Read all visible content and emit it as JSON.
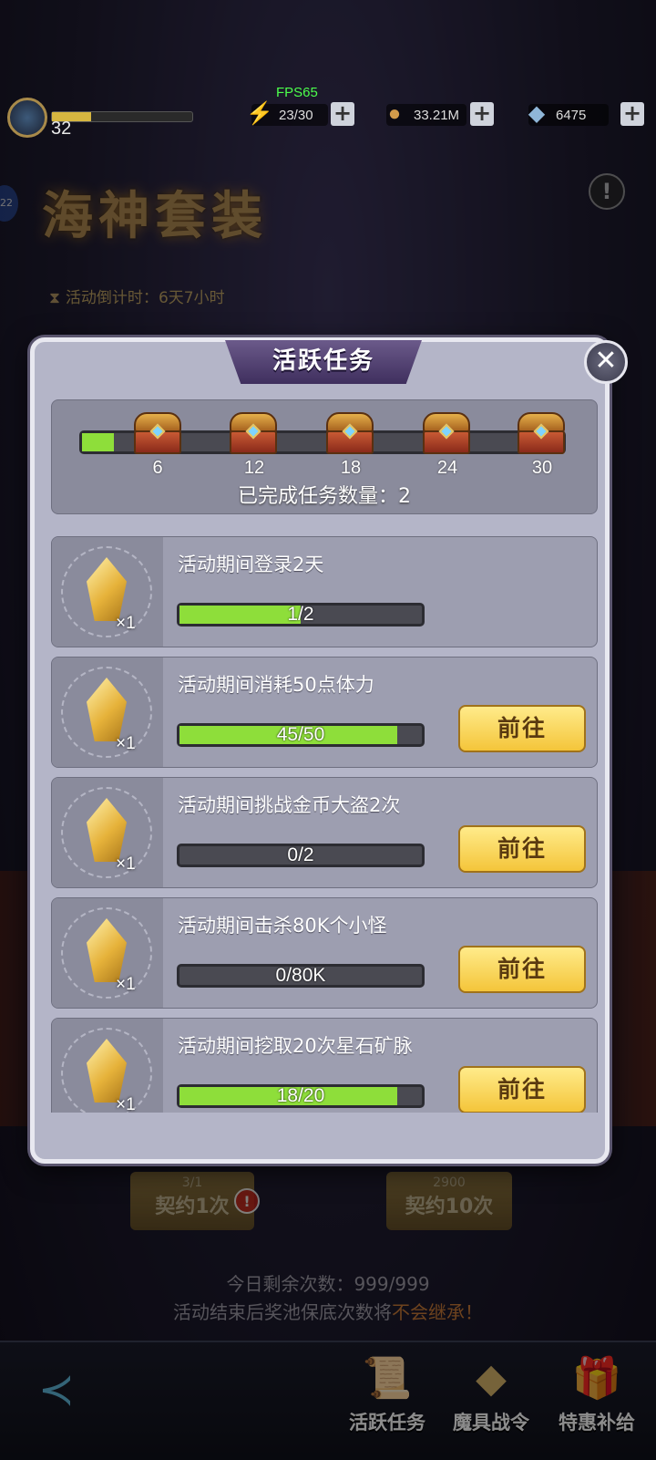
{
  "status": {
    "fps": "FPS65",
    "level": "32",
    "xp_fraction": 0.28,
    "stamina": "23/30",
    "gold": "33.21M",
    "diamonds": "6475"
  },
  "event": {
    "title": "海神套装",
    "countdown_label": "活动倒计时：",
    "countdown_value": "6天7小时",
    "help_glyph": "!",
    "side_badge": "22"
  },
  "dialog": {
    "title": "活跃任务",
    "close_glyph": "✕",
    "progress_fraction": 0.067,
    "milestones": [
      "6",
      "12",
      "18",
      "24",
      "30"
    ],
    "completed_label": "已完成任务数量：2",
    "tasks": [
      {
        "title": "活动期间登录2天",
        "progress_text": "1/2",
        "progress_fraction": 0.5,
        "reward_qty": "×1",
        "button": ""
      },
      {
        "title": "活动期间消耗50点体力",
        "progress_text": "45/50",
        "progress_fraction": 0.9,
        "reward_qty": "×1",
        "button": "前往"
      },
      {
        "title": "活动期间挑战金币大盗2次",
        "progress_text": "0/2",
        "progress_fraction": 0,
        "reward_qty": "×1",
        "button": "前往"
      },
      {
        "title": "活动期间击杀80K个小怪",
        "progress_text": "0/80K",
        "progress_fraction": 0,
        "reward_qty": "×1",
        "button": "前往"
      },
      {
        "title": "活动期间挖取20次星石矿脉",
        "progress_text": "18/20",
        "progress_fraction": 0.9,
        "reward_qty": "×1",
        "button": "前往"
      }
    ]
  },
  "contract": {
    "single_cost": "3/1",
    "single_label": "契约1次",
    "ten_cost": "2900",
    "ten_label": "契约10次",
    "alert_glyph": "!"
  },
  "footer": {
    "remaining": "今日剩余次数：999/999",
    "warning_prefix": "活动结束后奖池保底次数将",
    "warning_highlight": "不会继承！"
  },
  "bottom_nav": {
    "items": [
      "活跃任务",
      "魔具战令",
      "特惠补给"
    ]
  },
  "colors": {
    "progress_green": "#8ede3a",
    "button_gold": "#f4c53a",
    "dialog_bg": "#b4b5c8"
  }
}
